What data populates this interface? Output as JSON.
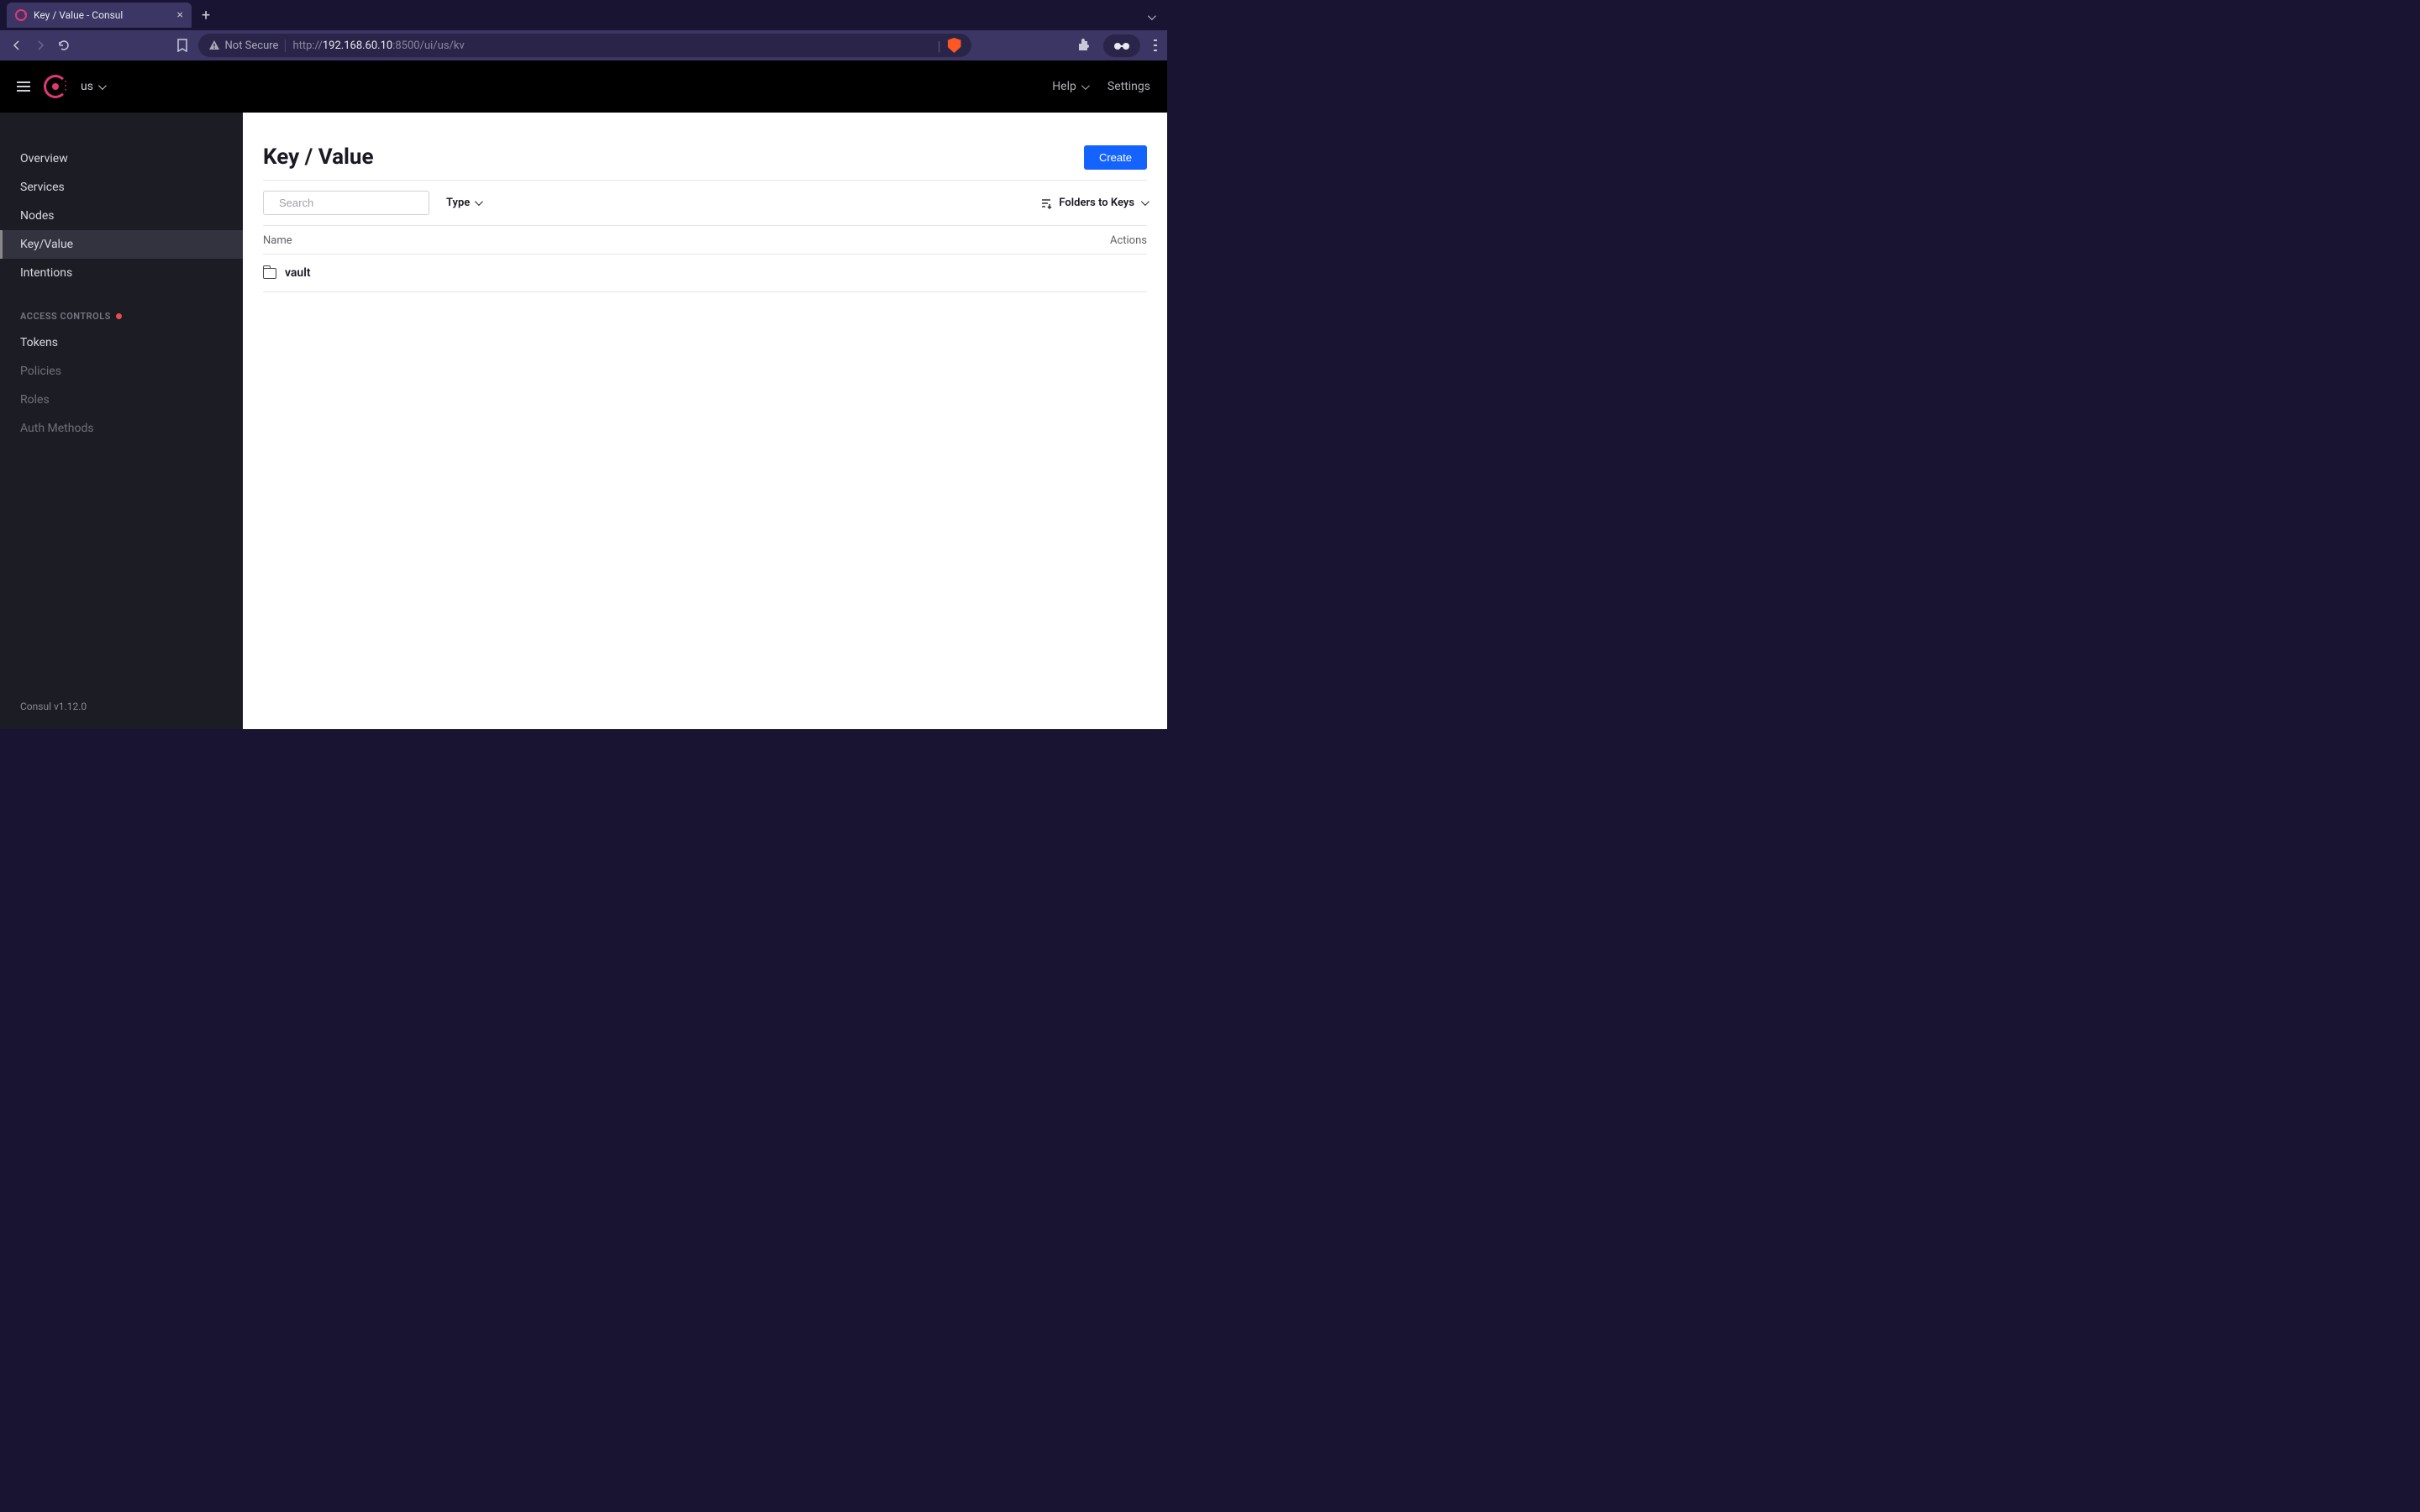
{
  "browser": {
    "tab_title": "Key / Value - Consul",
    "not_secure": "Not Secure",
    "url_prefix": "http://",
    "url_host": "192.168.60.10",
    "url_path": ":8500/ui/us/kv"
  },
  "header": {
    "datacenter": "us",
    "help": "Help",
    "settings": "Settings"
  },
  "sidebar": {
    "items": [
      {
        "label": "Overview",
        "active": false
      },
      {
        "label": "Services",
        "active": false
      },
      {
        "label": "Nodes",
        "active": false
      },
      {
        "label": "Key/Value",
        "active": true
      },
      {
        "label": "Intentions",
        "active": false
      }
    ],
    "section_title": "ACCESS CONTROLS",
    "access_items": [
      {
        "label": "Tokens",
        "dim": false
      },
      {
        "label": "Policies",
        "dim": true
      },
      {
        "label": "Roles",
        "dim": true
      },
      {
        "label": "Auth Methods",
        "dim": true
      }
    ],
    "footer": "Consul v1.12.0"
  },
  "main": {
    "title": "Key / Value",
    "create_label": "Create",
    "search_placeholder": "Search",
    "type_filter": "Type",
    "sort_label": "Folders to Keys",
    "columns": {
      "name": "Name",
      "actions": "Actions"
    },
    "rows": [
      {
        "name": "vault"
      }
    ]
  }
}
